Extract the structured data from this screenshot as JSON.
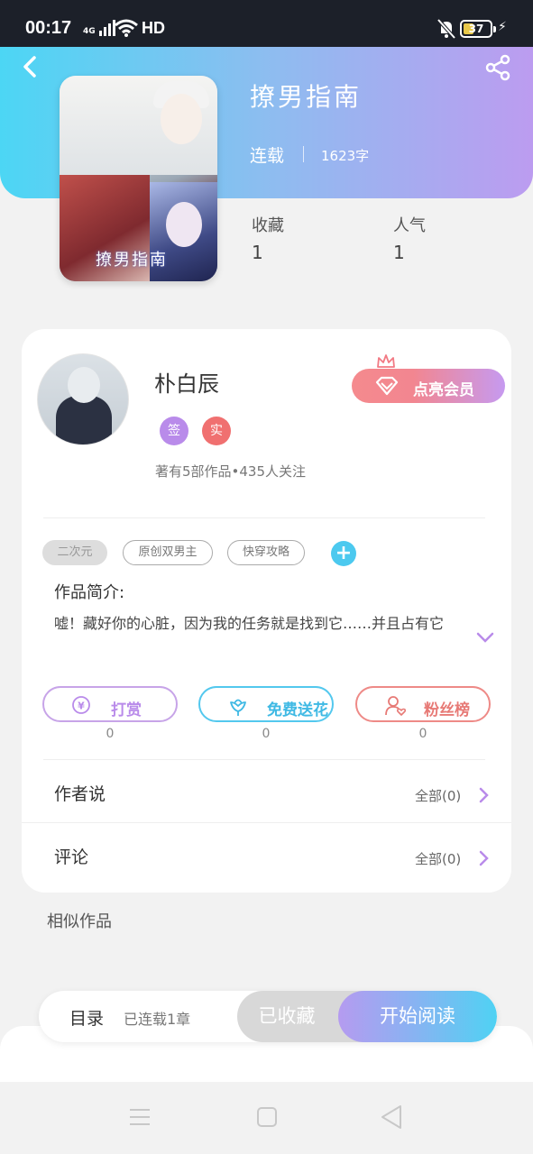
{
  "status_bar": {
    "time": "00:17",
    "network": "4G",
    "hd": "HD",
    "battery": "37"
  },
  "book": {
    "title": "撩男指南",
    "status": "连载",
    "word_count": "1623字",
    "cover_text": "撩男指南",
    "stats": [
      {
        "label": "收藏",
        "value": "1"
      },
      {
        "label": "人气",
        "value": "1"
      }
    ]
  },
  "author": {
    "name": "朴白辰",
    "badges": [
      "签",
      "实"
    ],
    "works_info": "著有5部作品•435人关注",
    "vip_button": "点亮会员"
  },
  "tags": [
    "二次元",
    "原创双男主",
    "快穿攻略"
  ],
  "tag_add": "+",
  "intro": {
    "title": "作品简介:",
    "text": "嘘！藏好你的心脏，因为我的任务就是找到它……并且占有它"
  },
  "actions": [
    {
      "label": "打赏",
      "count": "0",
      "icon": "yen-icon"
    },
    {
      "label": "免费送花",
      "count": "0",
      "icon": "flower-icon"
    },
    {
      "label": "粉丝榜",
      "count": "0",
      "icon": "user-heart-icon"
    }
  ],
  "sections": {
    "author_says": {
      "label": "作者说",
      "link": "全部(0)"
    },
    "comments": {
      "label": "评论",
      "link": "全部(0)"
    }
  },
  "similar_title": "相似作品",
  "bottom_bar": {
    "toc_label": "目录",
    "toc_progress": "已连载1章",
    "collected": "已收藏",
    "read": "开始阅读"
  },
  "colors": {
    "header_start": "#4cd6f4",
    "header_end": "#bc9cf0",
    "vip_pink": "#f58a8e",
    "tip_purple": "#b98bea",
    "flower_blue": "#3fb9e4",
    "fans_red": "#e77a76"
  }
}
